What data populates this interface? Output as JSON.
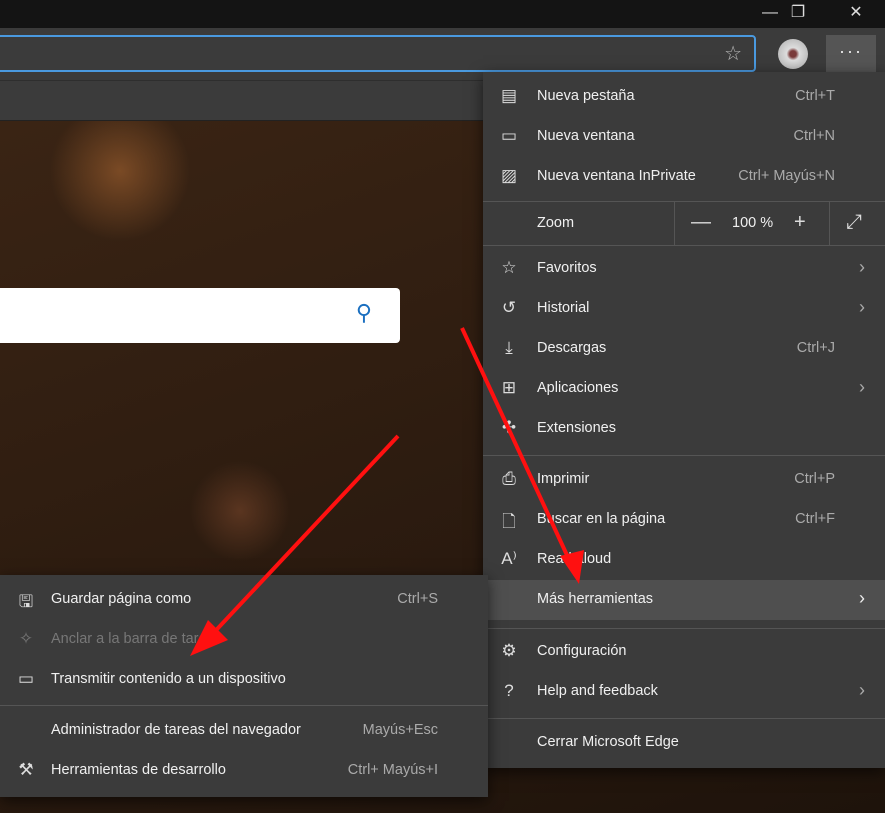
{
  "window": {
    "minimize": "—",
    "restore": "❐",
    "close": "✕"
  },
  "toolbar": {
    "more_label": "···",
    "favorite_icon": "☆"
  },
  "search": {
    "icon": "⚲"
  },
  "menu": {
    "items": [
      {
        "label": "Nueva pestaña",
        "shortcut": "Ctrl+T",
        "icon": "▤"
      },
      {
        "label": "Nueva ventana",
        "shortcut": "Ctrl+N",
        "icon": "▭"
      },
      {
        "label": "Nueva ventana InPrivate",
        "shortcut": "Ctrl+ Mayús+N",
        "icon": "▨"
      }
    ],
    "zoom": {
      "label": "Zoom",
      "minus": "—",
      "value": "100 %",
      "plus": "+",
      "fullscreen": "⤢"
    },
    "items2": [
      {
        "label": "Favoritos",
        "shortcut": "",
        "icon": "☆",
        "chevron": "›"
      },
      {
        "label": "Historial",
        "shortcut": "",
        "icon": "↺",
        "chevron": "›"
      },
      {
        "label": "Descargas",
        "shortcut": "Ctrl+J",
        "icon": "⤓"
      },
      {
        "label": "Aplicaciones",
        "shortcut": "",
        "icon": "⊞",
        "chevron": "›"
      },
      {
        "label": "Extensiones",
        "shortcut": "",
        "icon": "✣"
      }
    ],
    "items3": [
      {
        "label": "Imprimir",
        "shortcut": "Ctrl+P",
        "icon": "⎙"
      },
      {
        "label": "Buscar en la página",
        "shortcut": "Ctrl+F",
        "icon": "🗋"
      },
      {
        "label": "Read aloud",
        "shortcut": "",
        "icon": "A⁾"
      },
      {
        "label": "Más herramientas",
        "shortcut": "",
        "icon": "",
        "chevron": "›"
      }
    ],
    "items4": [
      {
        "label": "Configuración",
        "icon": "⚙"
      },
      {
        "label": "Help and feedback",
        "icon": "?",
        "chevron": "›"
      }
    ],
    "close": {
      "label": "Cerrar Microsoft Edge"
    }
  },
  "submenu": {
    "items": [
      {
        "label": "Guardar página como",
        "shortcut": "Ctrl+S",
        "icon": "🖫"
      },
      {
        "label": "Anclar a la barra de tareas",
        "shortcut": "",
        "icon": "✧"
      },
      {
        "label": "Transmitir contenido a un dispositivo",
        "shortcut": "",
        "icon": "▭"
      },
      {
        "label": "Administrador de tareas del navegador",
        "shortcut": "Mayús+Esc",
        "icon": ""
      },
      {
        "label": "Herramientas de desarrollo",
        "shortcut": "Ctrl+ Mayús+I",
        "icon": "⚒"
      }
    ]
  },
  "colors": {
    "accent": "#4a9ae0",
    "arrow": "#ff1010",
    "menu_bg": "#3b3b3b"
  }
}
